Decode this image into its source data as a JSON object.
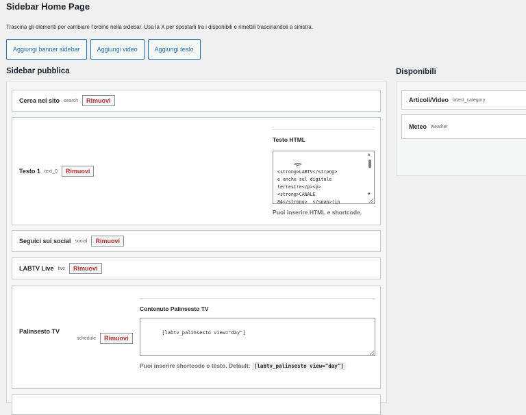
{
  "page": {
    "title": "Sidebar Home Page",
    "intro": "Trascina gli elementi per cambiare l'ordine nella sidebar. Usa la X per spostarli tra i disponibili e rimettili trascinandoli a sinistra."
  },
  "actions": {
    "add_banner": "Aggiungi banner sidebar",
    "add_video": "Aggiungi video",
    "add_text": "Aggiungi testo"
  },
  "public": {
    "title": "Sidebar pubblica",
    "remove_label": "Rimuovi",
    "widgets": [
      {
        "title": "Cerca nel sito",
        "slug": "search"
      },
      {
        "title": "Testo 1",
        "slug": "text_0",
        "settings_label": "Testo HTML",
        "content": "<p>\n<strong>LABTV</strong>\ne anche sul digitale\nterrestre</p><p>\n<strong>CANALE\n84</strong>  </span>(in",
        "help": "Puoi inserire HTML e shortcode."
      },
      {
        "title": "Seguici sui social",
        "slug": "social"
      },
      {
        "title": "LABTV Live",
        "slug": "live"
      },
      {
        "title": "Palinsesto TV",
        "slug": "schedule",
        "settings_label": "Contenuto Palinsesto TV",
        "content": "[labtv_palinsesto view=\"day\"]",
        "help": "Puoi inserire shortcode o testo. Default:",
        "help_code": "[labtv_palinsesto view=\"day\"]"
      }
    ]
  },
  "available": {
    "title": "Disponibili",
    "widgets": [
      {
        "title": "Articoli/Video",
        "slug": "latest_category"
      },
      {
        "title": "Meteo",
        "slug": "weather"
      }
    ]
  }
}
